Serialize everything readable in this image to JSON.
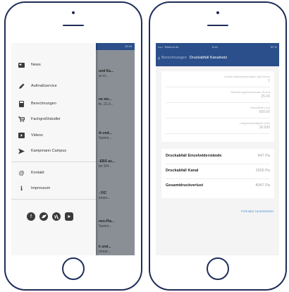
{
  "left_screen": {
    "status_bar": {
      "time": "12:13"
    },
    "peek_items": [
      {
        "line1": "und Ka...",
        "line2": "ar ei..."
      },
      {
        "line1": "ne ein...",
        "line2": "fe, 21.0..."
      },
      {
        "line1": "ik und...",
        "line2": "Summ..."
      },
      {
        "line1": "-EBS as...",
        "line2": "ter EH..."
      },
      {
        "line1": "- FIC",
        "line2": "ionen..."
      },
      {
        "line1": "nen-Pia...",
        "line2": "Summ..."
      },
      {
        "line1": "k und...",
        "line2": "mmer..."
      }
    ],
    "menu": {
      "items": [
        {
          "label": "News",
          "icon": "newspaper-icon"
        },
        {
          "label": "Aufmaßservice",
          "icon": "pencil-icon"
        },
        {
          "label": "Berechnungen",
          "icon": "calculator-icon"
        },
        {
          "label": "Fachgroßhändler",
          "icon": "cart-icon"
        },
        {
          "label": "Videos",
          "icon": "video-icon"
        },
        {
          "label": "Kampmann Campus",
          "icon": "graduation-icon"
        }
      ],
      "secondary": [
        {
          "label": "Kontakt",
          "icon": "at-icon"
        },
        {
          "label": "Impressum",
          "icon": "info-icon"
        }
      ],
      "social": [
        "facebook-icon",
        "twitter-icon",
        "xing-icon",
        "youtube-icon"
      ]
    }
  },
  "right_screen": {
    "status_bar": {
      "carrier": "••••○ Telekom.de",
      "time": "8:44",
      "battery": "52 %"
    },
    "nav": {
      "back_label": "Berechnungen",
      "title": "Druckabfall Kanalnetz"
    },
    "fields": [
      {
        "label": "Anzahl Kaltwasserkreislauf (alle Arme)",
        "value": "1"
      },
      {
        "label": "Rohrleitungsdurchmesser (Form)",
        "value": "25.00"
      },
      {
        "label": "Geschätzte (Lm)",
        "value": "600.00"
      },
      {
        "label": "Luftgeschwindigkeit (m/s)",
        "value": "30.000"
      }
    ],
    "results": [
      {
        "label": "Druckabfall Einzelwiderstände",
        "value": "647 Pa"
      },
      {
        "label": "Druckabfall Kanal",
        "value": "1900 Pa"
      },
      {
        "label": "Gesamtdruckverlust",
        "value": "4047 Pa"
      }
    ],
    "reset_label": "Formular zurücksetzen"
  }
}
